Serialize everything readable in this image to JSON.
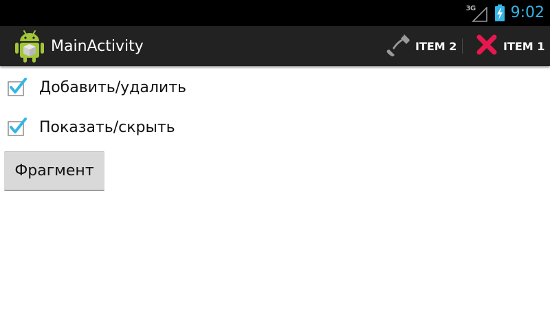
{
  "status_bar": {
    "network_type": "3G",
    "time": "9:02",
    "icons": [
      "signal-icon",
      "battery-charging-icon"
    ],
    "time_color": "#33b5e5"
  },
  "action_bar": {
    "title": "MainActivity",
    "app_icon": "android-icon",
    "items": [
      {
        "label": "ITEM 2",
        "icon": "phone-icon"
      },
      {
        "label": "ITEM 1",
        "icon": "close-icon",
        "icon_color": "#e8174f"
      }
    ]
  },
  "content": {
    "checkboxes": [
      {
        "label": "Добавить/удалить",
        "checked": true
      },
      {
        "label": "Показать/скрыть",
        "checked": true
      }
    ],
    "button_label": "Фрагмент",
    "accent_color": "#33b5e5"
  }
}
